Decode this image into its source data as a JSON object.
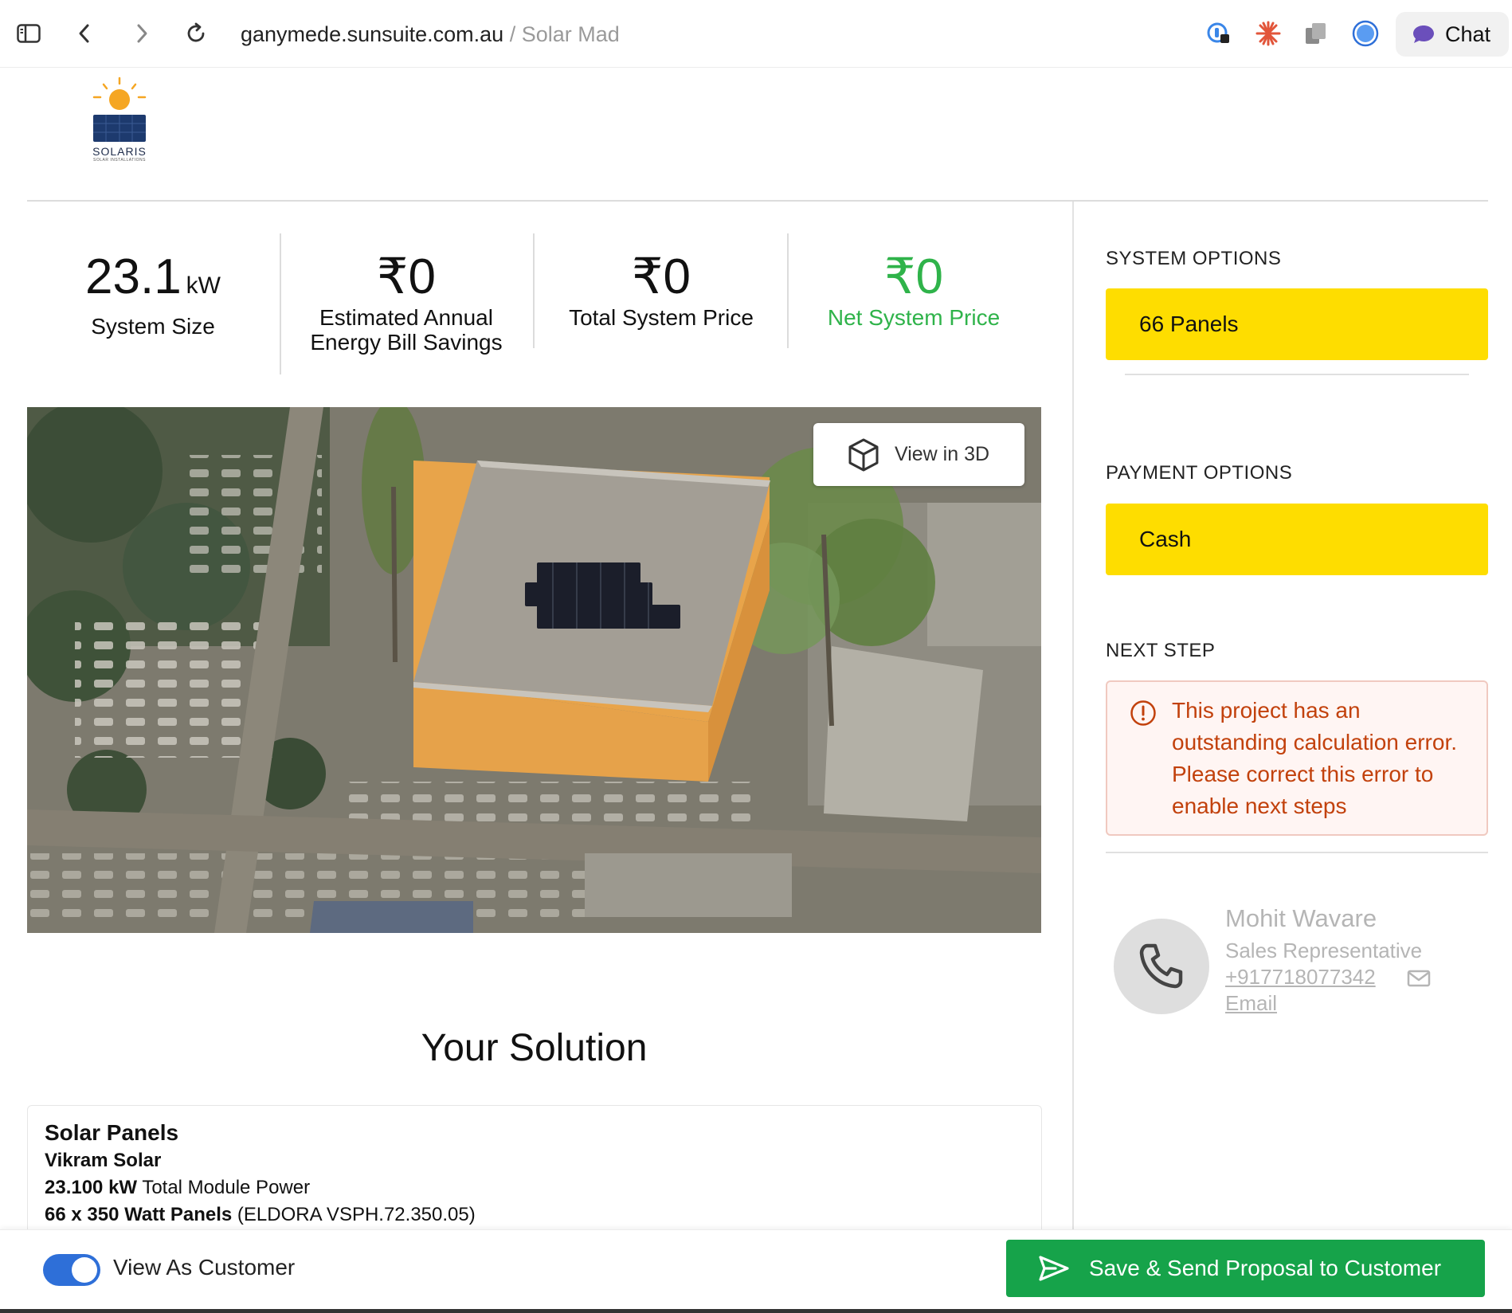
{
  "browser": {
    "url_domain": "ganymede.sunsuite.com.au",
    "url_separator": " / ",
    "url_title": "Solar Mad",
    "chat_label": "Chat"
  },
  "logo": {
    "name": "SOLARIS",
    "tagline": "SOLAR INSTALLATIONS"
  },
  "stats": {
    "system_size_value": "23.1",
    "system_size_unit": "kW",
    "system_size_label": "System Size",
    "savings_value": "₹0",
    "savings_label_line1": "Estimated Annual",
    "savings_label_line2": "Energy Bill Savings",
    "total_price_value": "₹0",
    "total_price_label": "Total System Price",
    "net_price_value": "₹0",
    "net_price_label": "Net System Price"
  },
  "map": {
    "view3d_label": "View in 3D"
  },
  "solution": {
    "title": "Your Solution",
    "card_heading": "Solar Panels",
    "brand": "Vikram Solar",
    "power_bold": "23.100 kW",
    "power_text": " Total Module Power",
    "panels_bold": "66 x 350 Watt Panels",
    "panels_text": " (ELDORA VSPH.72.350.05)"
  },
  "sidebar": {
    "system_options_title": "SYSTEM OPTIONS",
    "system_option_selected": "66 Panels",
    "payment_options_title": "PAYMENT OPTIONS",
    "payment_option_selected": "Cash",
    "next_step_title": "NEXT STEP",
    "error_message": "This project has an outstanding calculation error. Please correct this error to enable next steps",
    "rep_name": "Mohit Wavare",
    "rep_role": "Sales Representative",
    "rep_phone": "+917718077342",
    "rep_email_label": "Email"
  },
  "bottom": {
    "toggle_label": "View As Customer",
    "toggle_on": true,
    "save_button": "Save & Send Proposal to Customer"
  },
  "colors": {
    "accent_yellow": "#fedd00",
    "net_price_green": "#2fb34a",
    "save_green": "#16a34a",
    "error_orange": "#c2410c",
    "toggle_blue": "#2e6fd8"
  }
}
